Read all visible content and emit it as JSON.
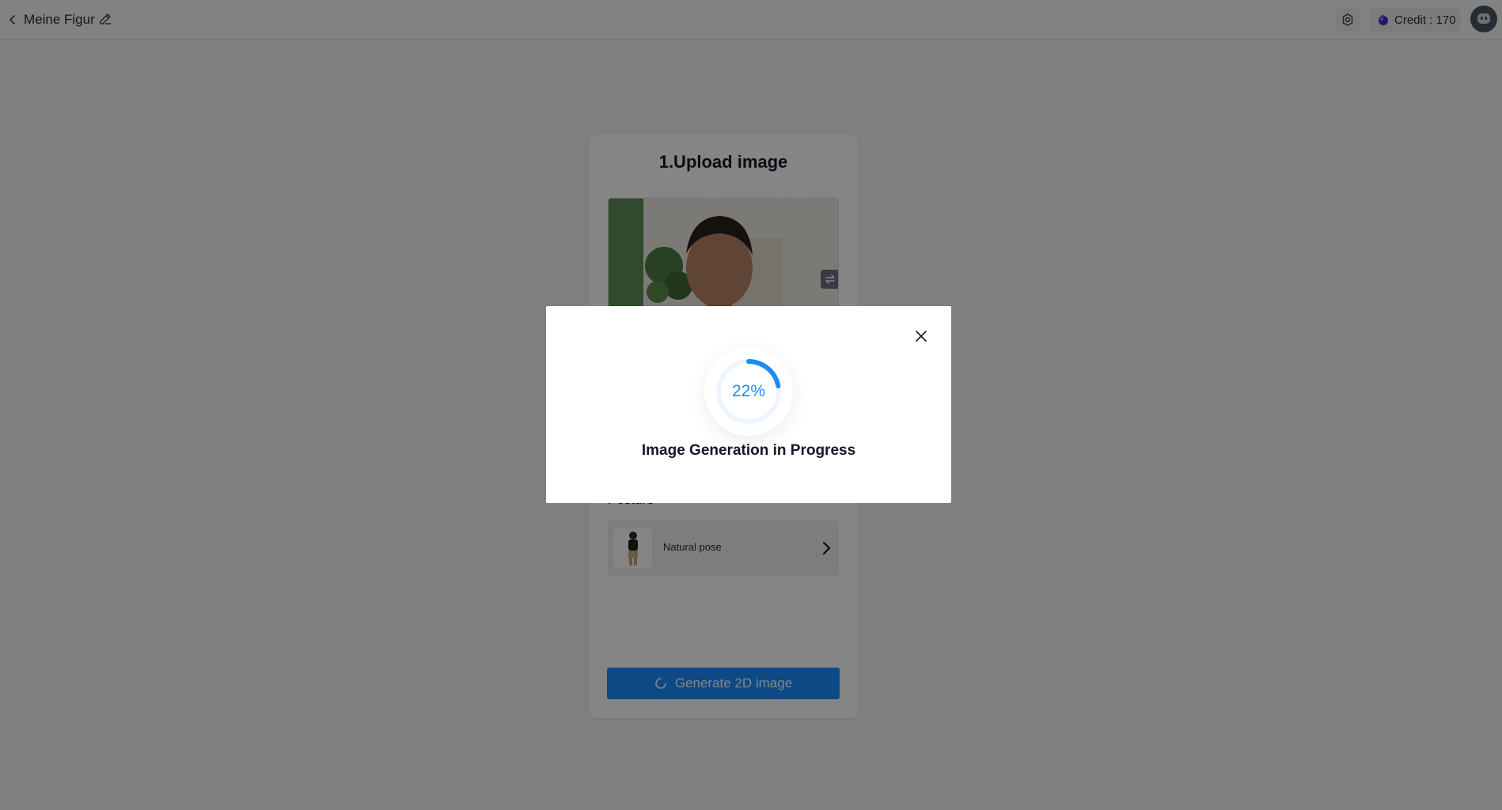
{
  "header": {
    "title": "Meine Figur",
    "credit_label": "Credit : 170"
  },
  "card": {
    "title": "1.Upload image",
    "posture_label": "Posture",
    "posture_option": "Natural pose",
    "generate_label": "Generate 2D image"
  },
  "modal": {
    "progress_percent": 22,
    "progress_text": "22%",
    "message": "Image Generation in Progress"
  },
  "colors": {
    "accent": "#1a8cff",
    "overlay": "rgba(0,0,0,0.48)"
  },
  "icons": {
    "back": "chevron-left-icon",
    "edit": "pencil-icon",
    "settings": "gear-icon",
    "credit": "gem-icon",
    "swap": "swap-icon",
    "posture_chevron": "chevron-right-icon",
    "close": "close-icon"
  }
}
